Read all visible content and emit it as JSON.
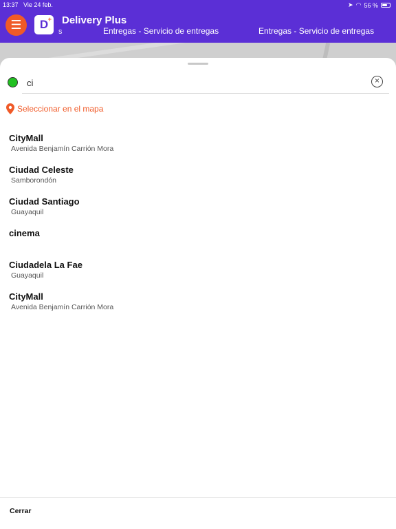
{
  "status_bar": {
    "time": "13:37",
    "date": "Vie 24 feb.",
    "battery": "56 %"
  },
  "header": {
    "app_title": "Delivery Plus",
    "logo_letter": "D",
    "hidden_fragment": "s",
    "tabs": [
      "Entregas - Servicio de entregas",
      "Entregas - Servicio de entregas"
    ]
  },
  "search": {
    "value": "ci",
    "placeholder": ""
  },
  "map_select_label": "Seleccionar en el mapa",
  "results": [
    {
      "name": "CityMall",
      "sub": "Avenida Benjamín Carrión Mora"
    },
    {
      "name": "Ciudad Celeste",
      "sub": "Samborondón"
    },
    {
      "name": "Ciudad Santiago",
      "sub": "Guayaquil"
    },
    {
      "name": "cinema",
      "sub": ""
    },
    {
      "name": "Ciudadela La Fae",
      "sub": "Guayaquil"
    },
    {
      "name": "CityMall",
      "sub": "Avenida Benjamín Carrión Mora"
    }
  ],
  "footer": {
    "close_label": "Cerrar"
  },
  "colors": {
    "header": "#5b2fd6",
    "accent": "#f05a28",
    "origin_dot": "#21c021"
  }
}
